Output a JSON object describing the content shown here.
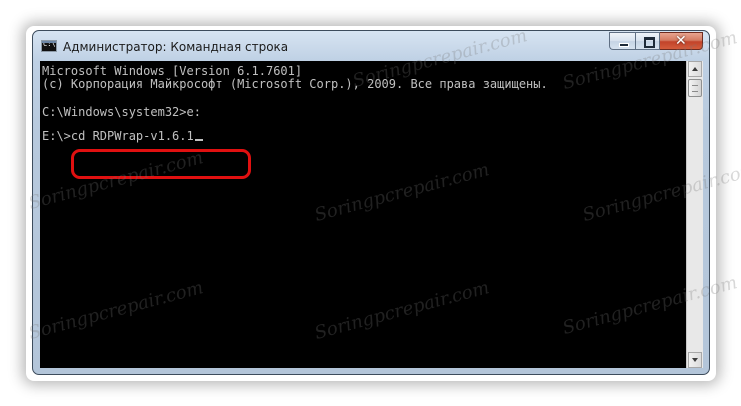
{
  "window": {
    "title": "Администратор: Командная строка",
    "icon": "cmd-icon",
    "caption_buttons": {
      "minimize": "minimize-icon",
      "maximize": "maximize-icon",
      "close": "✕"
    }
  },
  "console": {
    "lines": [
      "Microsoft Windows [Version 6.1.7601]",
      "(c) Корпорация Майкрософт (Microsoft Corp.), 2009. Все права защищены.",
      "",
      "C:\\Windows\\system32>e:",
      "",
      "E:\\>cd RDPWrap-v1.6.1"
    ],
    "highlight_color": "#e01010",
    "text_color": "#c0c0c0",
    "background_color": "#000000"
  },
  "watermark": {
    "text": "Soringpcrepair.com"
  }
}
